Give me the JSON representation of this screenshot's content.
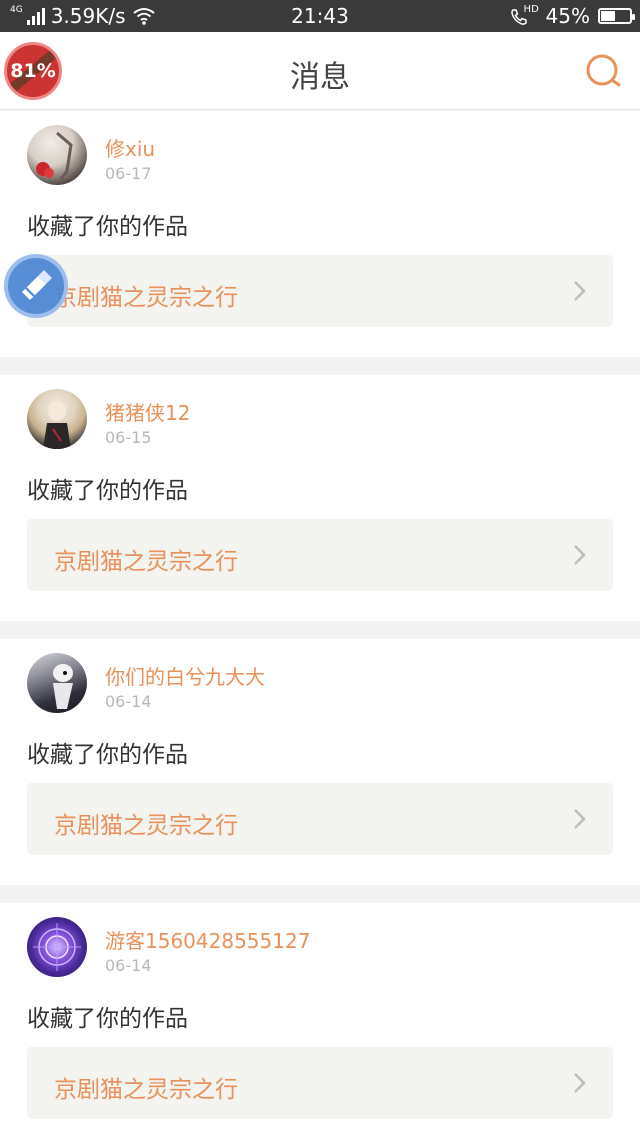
{
  "status_bar": {
    "network_tag": "4G",
    "speed": "3.59K/s",
    "time": "21:43",
    "hd_tag": "HD",
    "battery": "45%",
    "battery_level": 0.45
  },
  "header": {
    "title": "消息"
  },
  "overlay": {
    "memory_badge": "81%"
  },
  "messages": [
    {
      "user": "修xiu",
      "date": "06-17",
      "text": "收藏了你的作品",
      "work": "京剧猫之灵宗之行"
    },
    {
      "user": "猪猪侠12",
      "date": "06-15",
      "text": "收藏了你的作品",
      "work": "京剧猫之灵宗之行"
    },
    {
      "user": "你们的白兮九大大",
      "date": "06-14",
      "text": "收藏了你的作品",
      "work": "京剧猫之灵宗之行"
    },
    {
      "user": "游客1560428555127",
      "date": "06-14",
      "text": "收藏了你的作品",
      "work": "京剧猫之灵宗之行"
    }
  ],
  "colors": {
    "accent": "#e8915a",
    "divider": "#f2f2f2",
    "status_bar": "#3a3a3a"
  }
}
